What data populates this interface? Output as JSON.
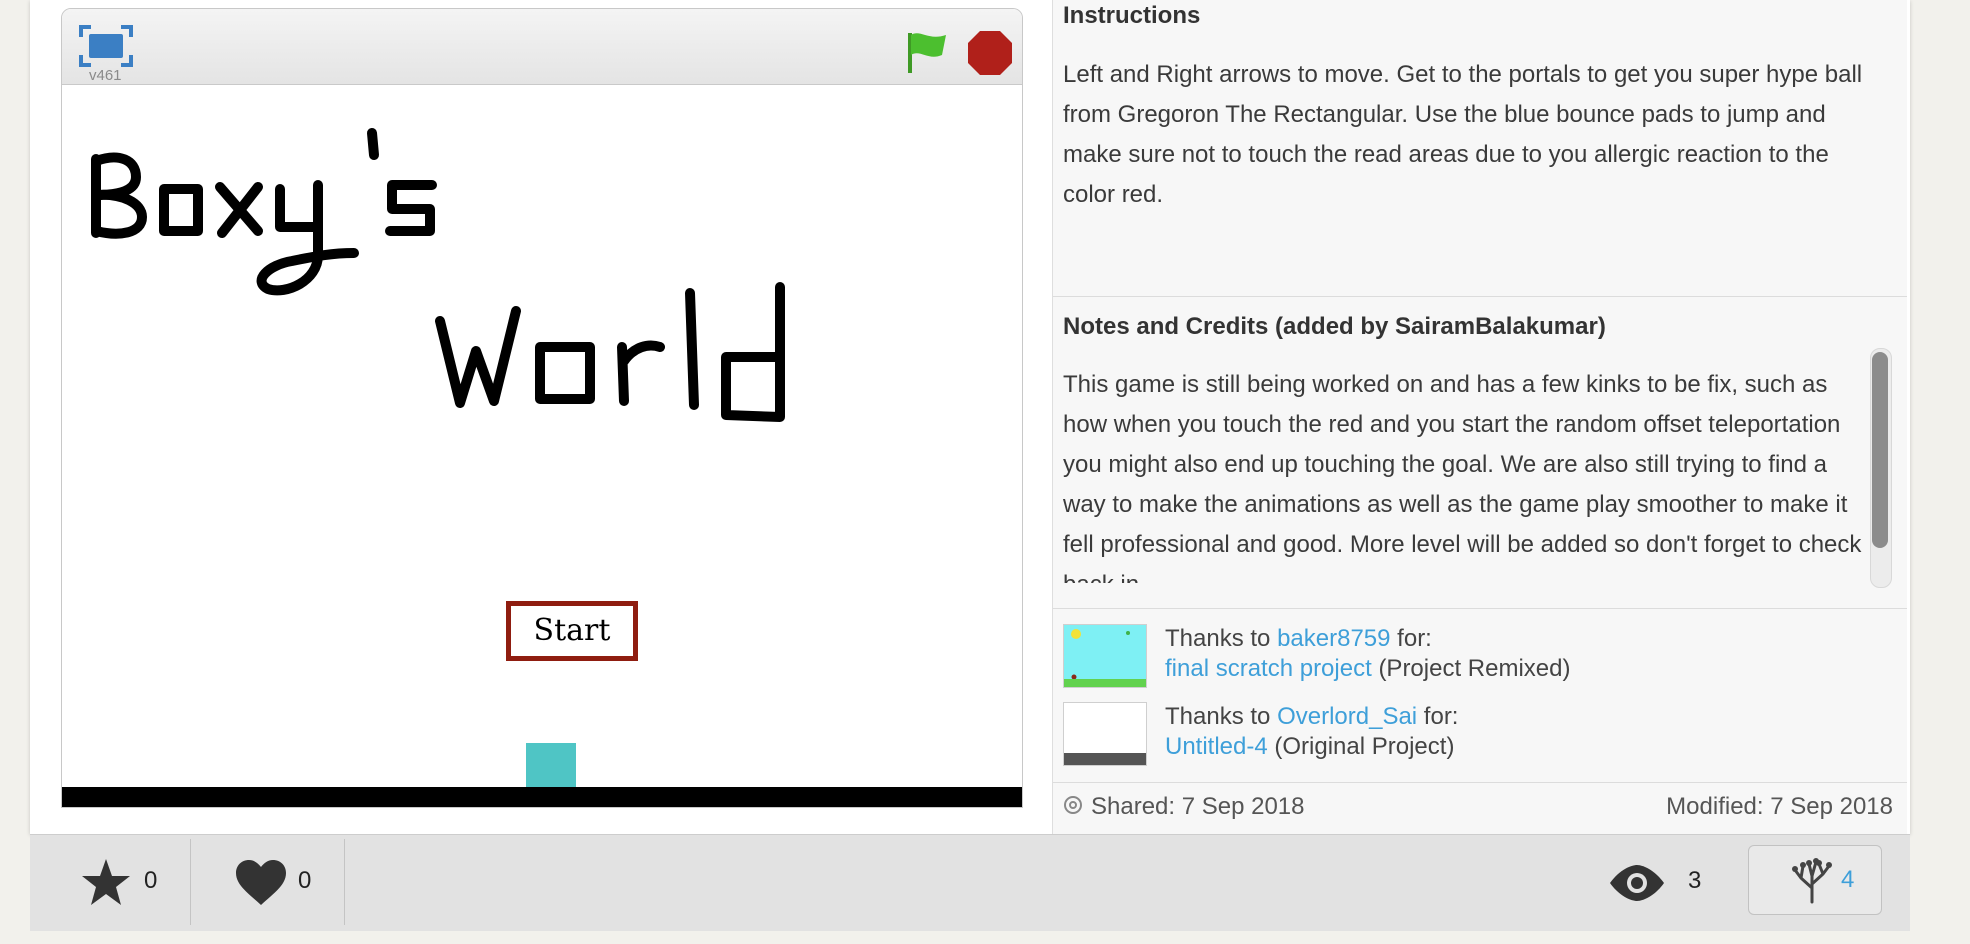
{
  "player": {
    "version": "v461",
    "start_label": "Start",
    "title_line1": "Boxy's",
    "title_line2": "World"
  },
  "instructions": {
    "title": "Instructions",
    "text": "Left and Right arrows to move. Get to the portals to get you super hype ball from Gregoron The Rectangular. Use the blue bounce pads to jump and make sure not to touch the read areas due to you allergic reaction to the color red."
  },
  "notes": {
    "title": "Notes and Credits (added by SairamBalakumar)",
    "text": "This game is still being worked on and has a few kinks to be fix, such as how when you touch the red and you start the random offset teleportation you might also end up touching the goal. We are also still trying to find a way to make the animations as well as the game play smoother to make it fell professional and good. More level will be added so don't forget to check back in"
  },
  "credits": [
    {
      "prefix": "Thanks to",
      "user": "baker8759",
      "suffix": "for:",
      "project": "final scratch project",
      "kind": "(Project Remixed)"
    },
    {
      "prefix": "Thanks to",
      "user": "Overlord_Sai",
      "suffix": "for:",
      "project": "Untitled-4",
      "kind": "(Original Project)"
    }
  ],
  "meta": {
    "shared": "Shared: 7 Sep 2018",
    "modified": "Modified: 7 Sep 2018"
  },
  "stats": {
    "favorites": "0",
    "loves": "0",
    "views": "3",
    "remixes": "4"
  },
  "colors": {
    "link": "#3e9fd9",
    "stop": "#b0201a",
    "flag": "#4cbf2f",
    "sprite": "#4fc5c5",
    "start_border": "#8f1d10"
  }
}
